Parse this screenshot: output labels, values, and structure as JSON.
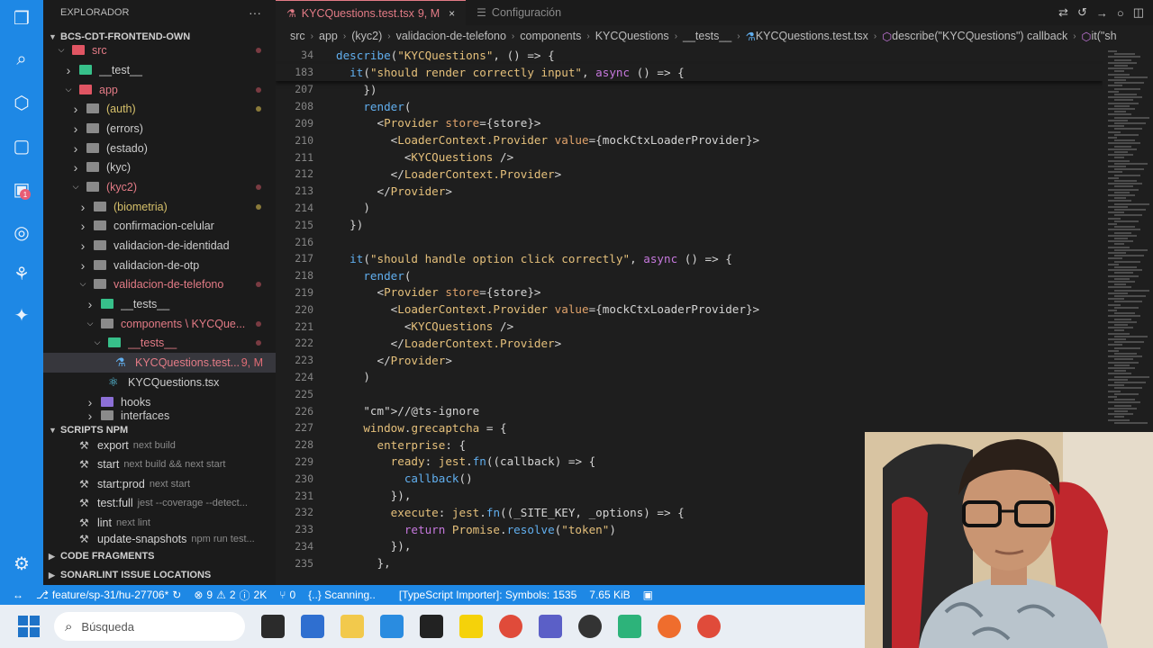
{
  "sidebar": {
    "title": "EXPLORADOR",
    "more": "···",
    "project": "BCS-CDT-FRONTEND-OWN",
    "tree": [
      {
        "label": "src",
        "color": "red"
      },
      {
        "label": "__test__",
        "color": "normal"
      },
      {
        "label": "app",
        "color": "red"
      },
      {
        "label": "(auth)",
        "color": "yellow"
      },
      {
        "label": "(errors)",
        "color": "normal"
      },
      {
        "label": "(estado)",
        "color": "normal"
      },
      {
        "label": "(kyc)",
        "color": "normal"
      },
      {
        "label": "(kyc2)",
        "color": "red"
      },
      {
        "label": "(biometria)",
        "color": "yellow"
      },
      {
        "label": "confirmacion-celular",
        "color": "normal"
      },
      {
        "label": "validacion-de-identidad",
        "color": "normal"
      },
      {
        "label": "validacion-de-otp",
        "color": "normal"
      },
      {
        "label": "validacion-de-telefono",
        "color": "red"
      },
      {
        "label": "__tests__",
        "color": "normal"
      },
      {
        "label": "components \\ KYCQue...",
        "color": "red"
      },
      {
        "label": "__tests__",
        "color": "red"
      },
      {
        "label": "KYCQuestions.test...",
        "color": "red",
        "desc": "9, M"
      },
      {
        "label": "KYCQuestions.tsx",
        "color": "normal"
      },
      {
        "label": "hooks",
        "color": "normal"
      },
      {
        "label": "interfaces",
        "color": "normal"
      }
    ],
    "scripts_title": "SCRIPTS NPM",
    "scripts": [
      {
        "name": "export",
        "cmd": "next build"
      },
      {
        "name": "start",
        "cmd": "next build && next start"
      },
      {
        "name": "start:prod",
        "cmd": "next start"
      },
      {
        "name": "test:full",
        "cmd": "jest --coverage --detect..."
      },
      {
        "name": "lint",
        "cmd": "next lint"
      },
      {
        "name": "update-snapshots",
        "cmd": "npm run test..."
      }
    ],
    "code_fragments": "CODE FRAGMENTS",
    "sonarlint": "SONARLINT ISSUE LOCATIONS"
  },
  "tabs": [
    {
      "label": "KYCQuestions.test.tsx",
      "suffix": "9, M",
      "close": "×"
    },
    {
      "label": "Configuración"
    }
  ],
  "breadcrumb": [
    "src",
    "app",
    "(kyc2)",
    "validacion-de-telefono",
    "components",
    "KYCQuestions",
    "__tests__",
    "KYCQuestions.test.tsx",
    "describe(\"KYCQuestions\") callback",
    "it(\"sh"
  ],
  "editor": {
    "sticky": [
      {
        "n": "34",
        "t": "describe(\"KYCQuestions\", () => {"
      },
      {
        "n": "183",
        "t": "  it(\"should render correctly input\", async () => {"
      }
    ],
    "lines": [
      {
        "n": "207",
        "t": "    })"
      },
      {
        "n": "208",
        "t": "    render("
      },
      {
        "n": "209",
        "t": "      <Provider store={store}>"
      },
      {
        "n": "210",
        "t": "        <LoaderContext.Provider value={mockCtxLoaderProvider}>"
      },
      {
        "n": "211",
        "t": "          <KYCQuestions />"
      },
      {
        "n": "212",
        "t": "        </LoaderContext.Provider>"
      },
      {
        "n": "213",
        "t": "      </Provider>"
      },
      {
        "n": "214",
        "t": "    )"
      },
      {
        "n": "215",
        "t": "  })"
      },
      {
        "n": "216",
        "t": ""
      },
      {
        "n": "217",
        "t": "  it(\"should handle option click correctly\", async () => {"
      },
      {
        "n": "218",
        "t": "    render("
      },
      {
        "n": "219",
        "t": "      <Provider store={store}>"
      },
      {
        "n": "220",
        "t": "        <LoaderContext.Provider value={mockCtxLoaderProvider}>"
      },
      {
        "n": "221",
        "t": "          <KYCQuestions />"
      },
      {
        "n": "222",
        "t": "        </LoaderContext.Provider>"
      },
      {
        "n": "223",
        "t": "      </Provider>"
      },
      {
        "n": "224",
        "t": "    )"
      },
      {
        "n": "225",
        "t": ""
      },
      {
        "n": "226",
        "t": "    //@ts-ignore"
      },
      {
        "n": "227",
        "t": "    window.grecaptcha = {"
      },
      {
        "n": "228",
        "t": "      enterprise: {"
      },
      {
        "n": "229",
        "t": "        ready: jest.fn((callback) => {"
      },
      {
        "n": "230",
        "t": "          callback()"
      },
      {
        "n": "231",
        "t": "        }),"
      },
      {
        "n": "232",
        "t": "        execute: jest.fn((_SITE_KEY, _options) => {"
      },
      {
        "n": "233",
        "t": "          return Promise.resolve(\"token\")"
      },
      {
        "n": "234",
        "t": "        }),"
      },
      {
        "n": "235",
        "t": "      },"
      }
    ]
  },
  "status": {
    "branch": "feature/sp-31/hu-27706*",
    "errors": "9",
    "warnings": "2",
    "info": "2K",
    "ports": "0",
    "scanning": "{..} Scanning..",
    "importer": "[TypeScript Importer]: Symbols: 1535",
    "size": "7.65 KiB"
  },
  "taskbar": {
    "search_placeholder": "Búsqueda"
  },
  "colors": {
    "accent": "#1e88e5",
    "modified": "#e37b86"
  }
}
